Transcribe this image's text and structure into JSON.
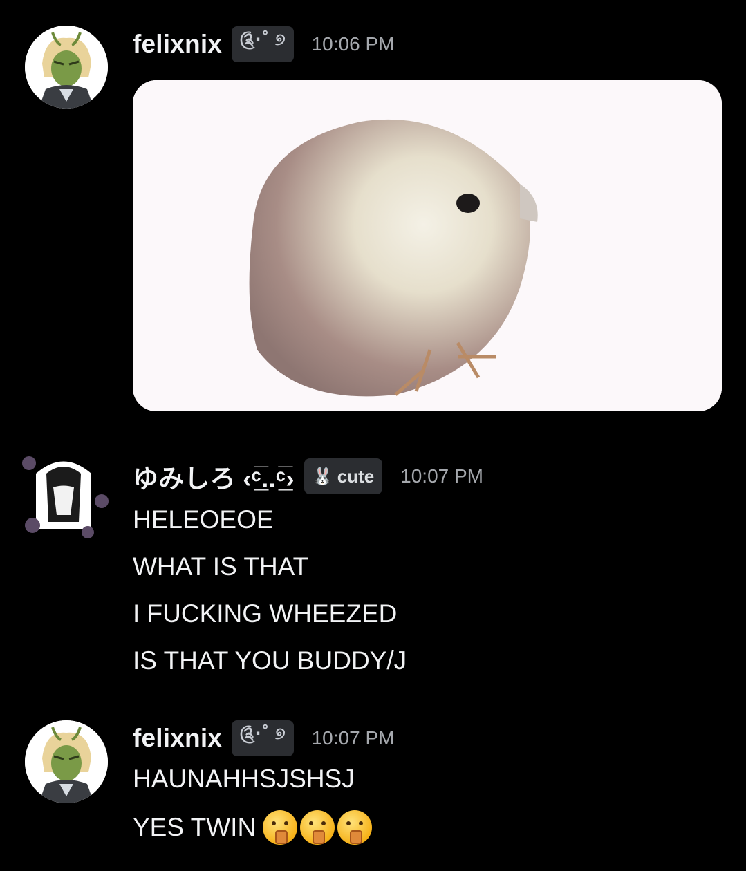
{
  "messages": [
    {
      "username": "felixnix",
      "tag_glyph": "༊·˚ ୭",
      "timestamp": "10:06 PM"
    },
    {
      "username": "ゆみしろ ‹ᶜ̲̅..ᶜ̲̅›",
      "tag_glyph": "🐰",
      "tag_text": "cute",
      "timestamp": "10:07 PM",
      "lines": [
        "HELEOEOE",
        "WHAT IS THAT",
        "I FUCKING WHEEZED",
        "IS THAT YOU BUDDY/J"
      ]
    },
    {
      "username": "felixnix",
      "tag_glyph": "༊·˚ ୭",
      "timestamp": "10:07 PM",
      "lines": [
        "HAUNAHHSJSHSJ",
        "YES TWIN"
      ],
      "emoji": "shushing-face-icon"
    }
  ]
}
